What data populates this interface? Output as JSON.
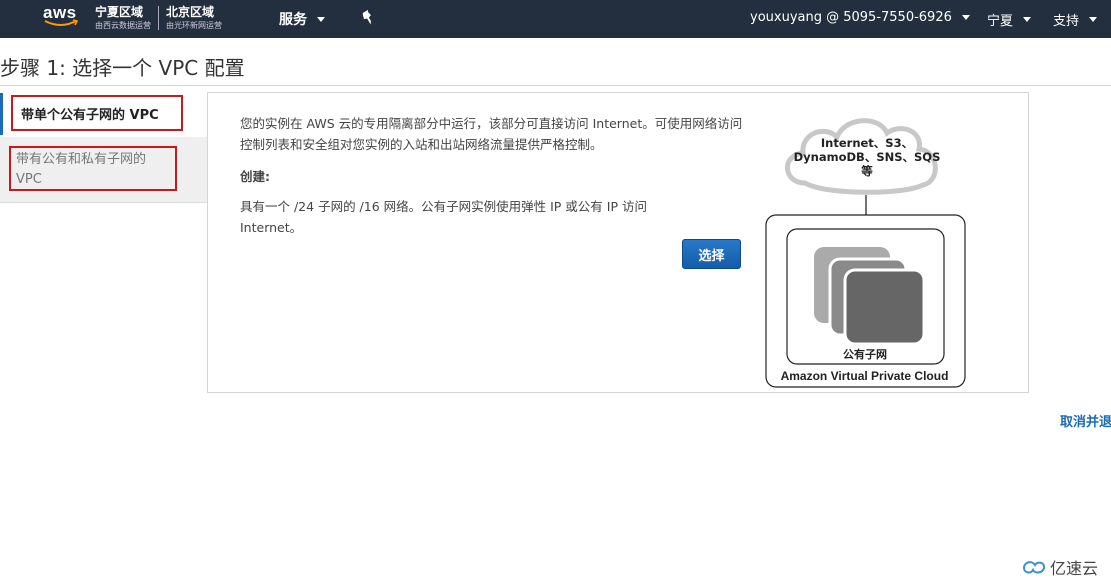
{
  "topnav": {
    "logo_text": "aws",
    "region1": {
      "title": "宁夏区域",
      "sub": "由西云数据运营"
    },
    "region2": {
      "title": "北京区域",
      "sub": "由光环新网运营"
    },
    "services_label": "服务",
    "account_label": "youxuyang @ 5095-7550-6926",
    "region_label": "宁夏",
    "support_label": "支持"
  },
  "page": {
    "title": "步骤 1: 选择一个 VPC 配置"
  },
  "tabs": [
    {
      "label": "带单个公有子网的 VPC",
      "selected": true
    },
    {
      "label": "带有公有和私有子网的 VPC",
      "selected": false
    }
  ],
  "panel": {
    "description": "您的实例在 AWS 云的专用隔离部分中运行，该部分可直接访问 Internet。可使用网络访问控制列表和安全组对您实例的入站和出站网络流量提供严格控制。",
    "create_label": "创建:",
    "create_description": "具有一个 /24 子网的 /16 网络。公有子网实例使用弹性 IP 或公有 IP 访问 Internet。",
    "select_button": "选择"
  },
  "diagram": {
    "cloud_text": "Internet、S3、DynamoDB、SNS、SQS 等",
    "subnet_label": "公有子网",
    "vpc_label": "Amazon Virtual Private Cloud"
  },
  "footer": {
    "cancel_link": "取消并退出"
  },
  "watermark": {
    "text": "亿速云"
  },
  "colors": {
    "nav_bg": "#232f3e",
    "accent": "#1a6bb8",
    "highlight_border": "#d0161d"
  }
}
